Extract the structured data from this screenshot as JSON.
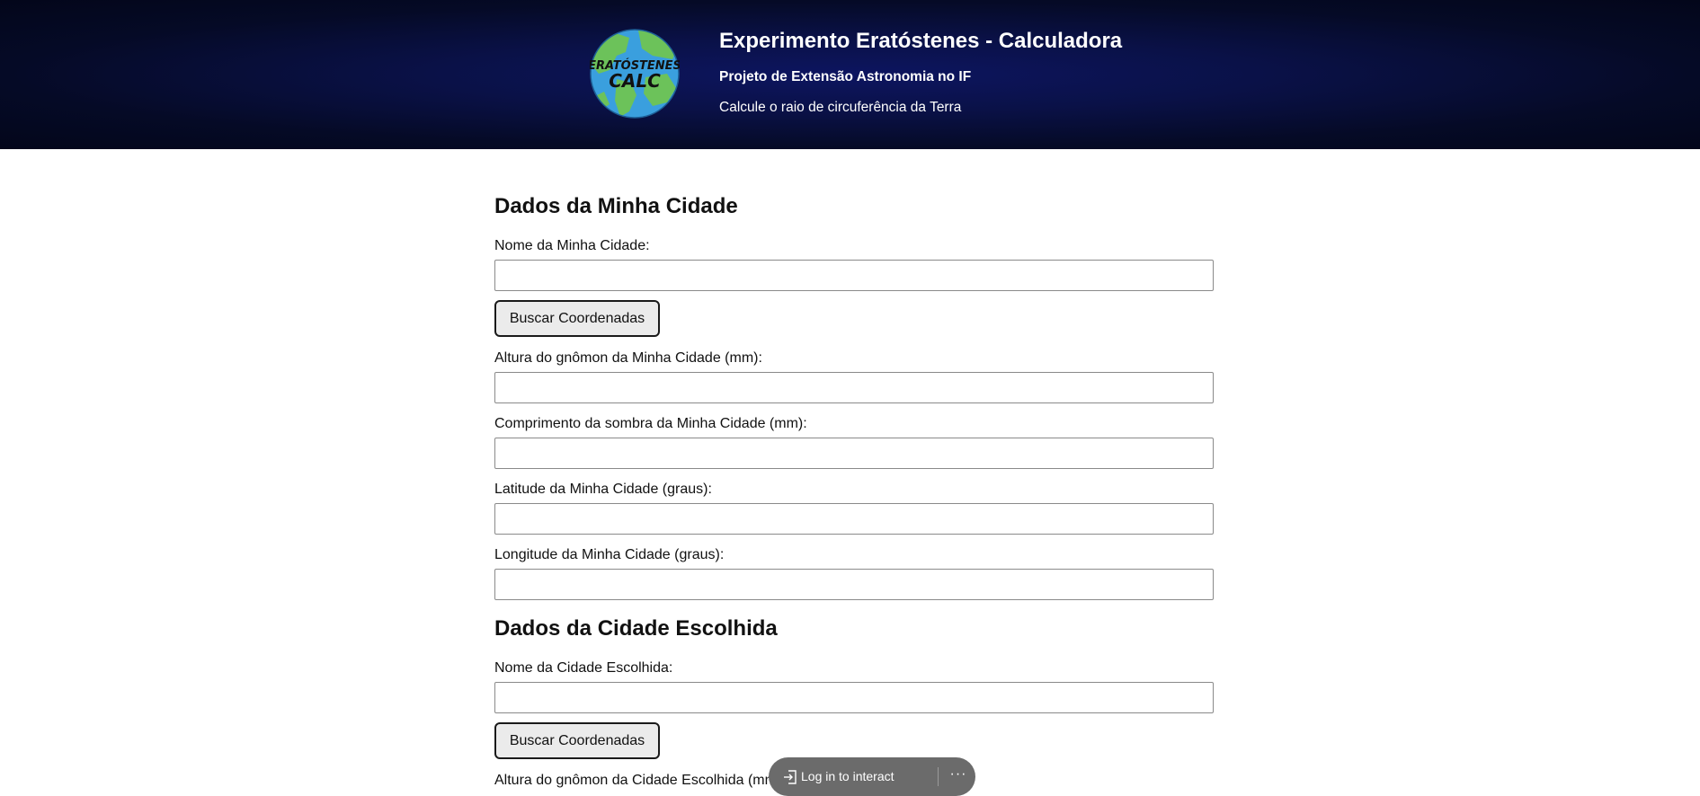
{
  "header": {
    "logo_line1": "ERATÓSTENES",
    "logo_line2": "CALC",
    "title": "Experimento Eratóstenes - Calculadora",
    "subtitle": "Projeto de Extensão Astronomia no IF",
    "tagline": "Calcule o raio de circuferência da Terra"
  },
  "my_city": {
    "heading": "Dados da Minha Cidade",
    "name_label": "Nome da Minha Cidade:",
    "name_value": "",
    "search_button": "Buscar Coordenadas",
    "gnomon_label": "Altura do gnômon da Minha Cidade (mm):",
    "gnomon_value": "",
    "shadow_label": "Comprimento da sombra da Minha Cidade (mm):",
    "shadow_value": "",
    "latitude_label": "Latitude da Minha Cidade (graus):",
    "latitude_value": "",
    "longitude_label": "Longitude da Minha Cidade (graus):",
    "longitude_value": ""
  },
  "chosen_city": {
    "heading": "Dados da Cidade Escolhida",
    "name_label": "Nome da Cidade Escolhida:",
    "name_value": "",
    "search_button": "Buscar Coordenadas",
    "gnomon_label": "Altura do gnômon da Cidade Escolhida (mm):"
  },
  "overlay": {
    "login_text": "Log in to interact",
    "more_label": "···"
  },
  "colors": {
    "header_background": "#0a1147",
    "button_background": "#ebebeb",
    "overlay_background": "#6b6b6b"
  },
  "icons": {
    "logo": "earth-globe-icon",
    "login": "login-arrow-icon",
    "more": "more-dots-icon"
  }
}
